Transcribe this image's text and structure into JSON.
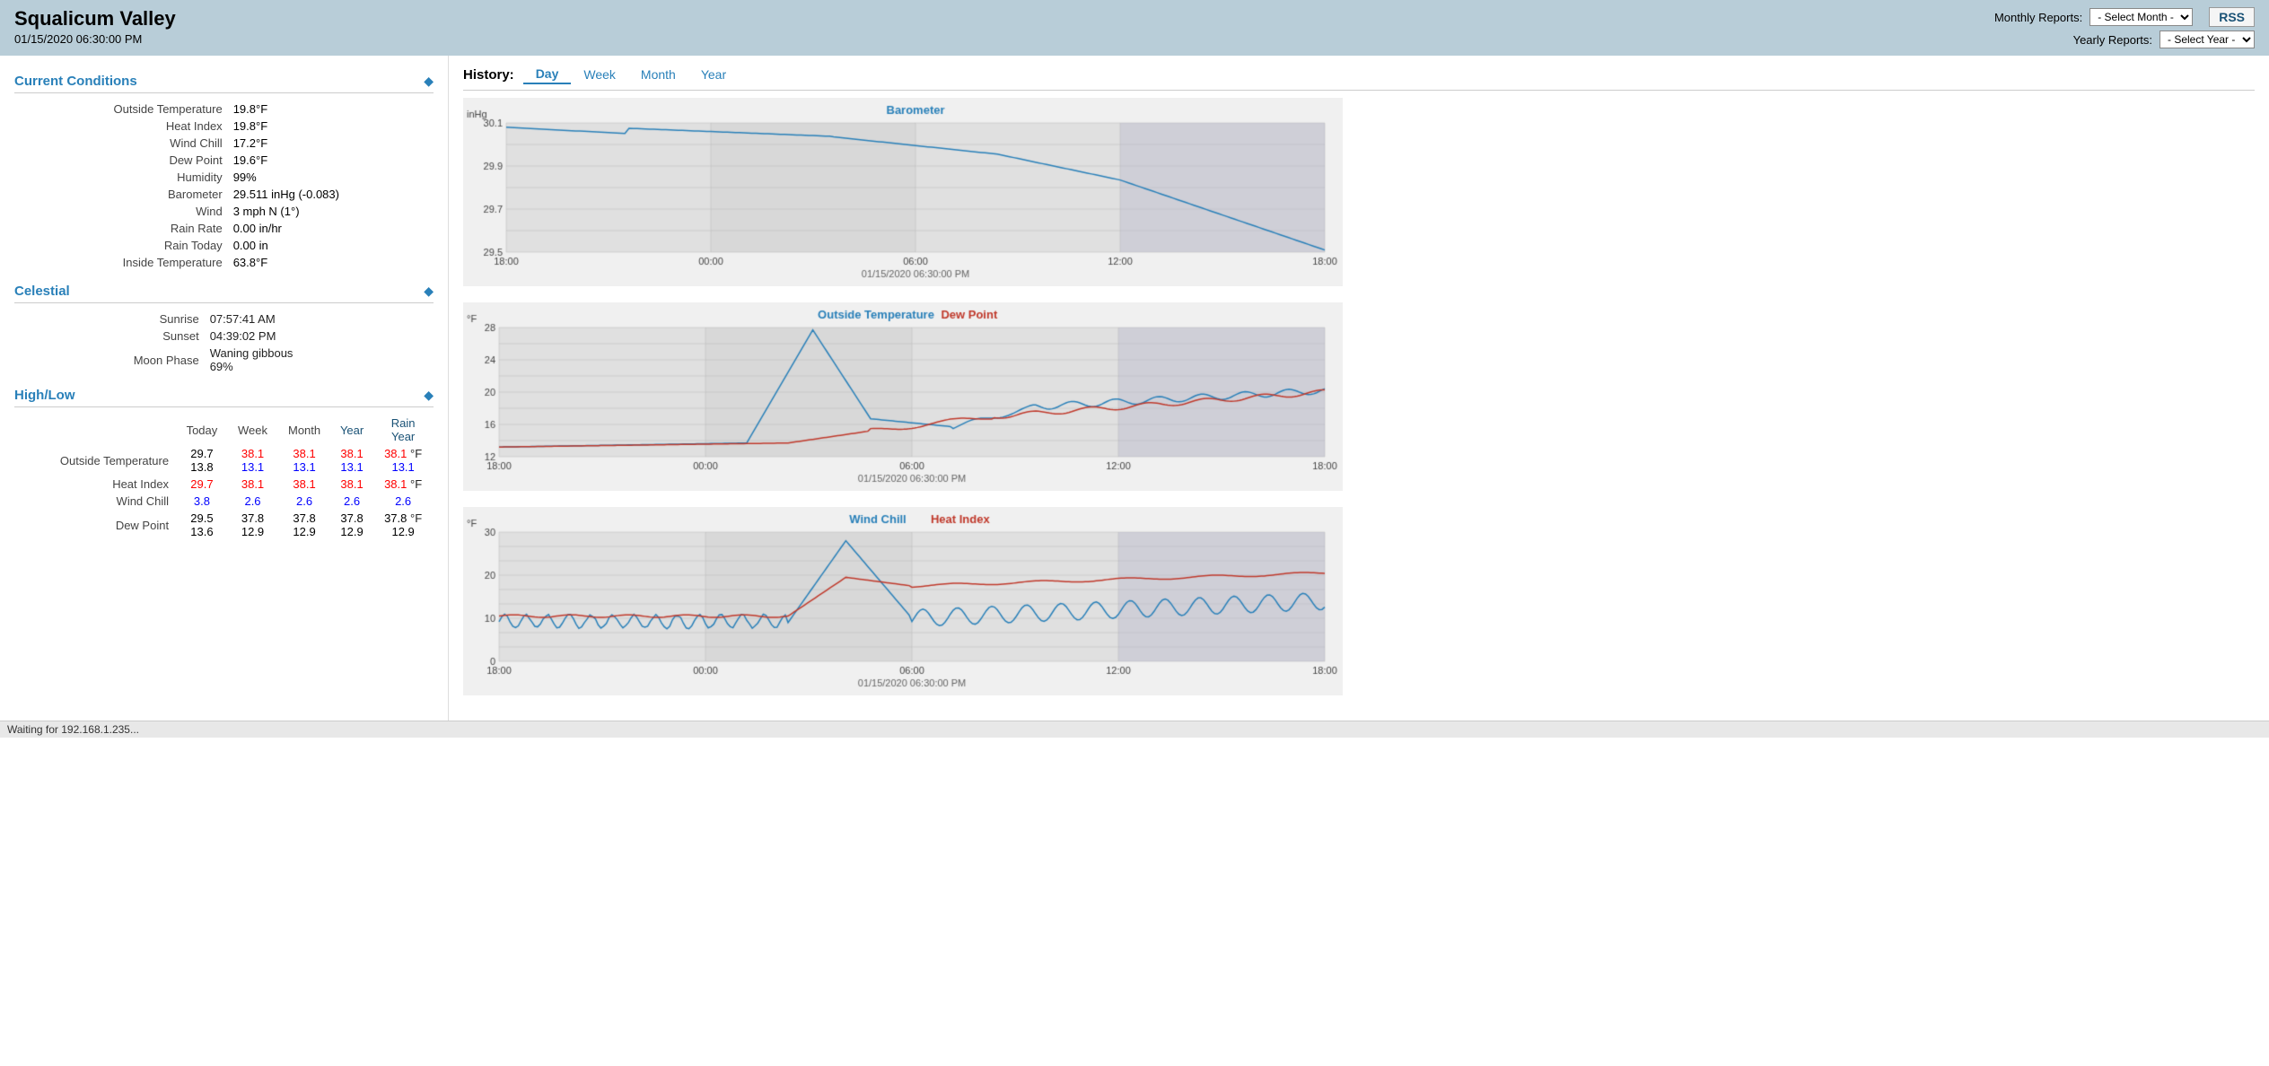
{
  "header": {
    "title": "Squalicum Valley",
    "datetime": "01/15/2020 06:30:00 PM",
    "monthly_reports_label": "Monthly Reports:",
    "yearly_reports_label": "Yearly Reports:",
    "select_month_placeholder": "- Select Month -",
    "select_year_placeholder": "- Select Year -",
    "rss_label": "RSS"
  },
  "current_conditions": {
    "section_title": "Current Conditions",
    "items": [
      {
        "label": "Outside Temperature",
        "value": "19.8°F"
      },
      {
        "label": "Heat Index",
        "value": "19.8°F"
      },
      {
        "label": "Wind Chill",
        "value": "17.2°F"
      },
      {
        "label": "Dew Point",
        "value": "19.6°F"
      },
      {
        "label": "Humidity",
        "value": "99%"
      },
      {
        "label": "Barometer",
        "value": "29.511 inHg (-0.083)"
      },
      {
        "label": "Wind",
        "value": "3 mph N (1°)"
      },
      {
        "label": "Rain Rate",
        "value": "0.00 in/hr"
      },
      {
        "label": "Rain Today",
        "value": "0.00 in"
      },
      {
        "label": "Inside Temperature",
        "value": "63.8°F"
      }
    ]
  },
  "celestial": {
    "section_title": "Celestial",
    "items": [
      {
        "label": "Sunrise",
        "value": "07:57:41 AM"
      },
      {
        "label": "Sunset",
        "value": "04:39:02 PM"
      },
      {
        "label": "Moon Phase",
        "value": "Waning gibbous\n69%"
      }
    ]
  },
  "highlow": {
    "section_title": "High/Low",
    "col_headers": [
      "Today",
      "Week",
      "Month",
      "Year",
      "Rain\nYear"
    ],
    "rows": [
      {
        "label": "Outside Temperature",
        "values": [
          [
            "29.7",
            "13.8"
          ],
          [
            "38.1",
            "13.1"
          ],
          [
            "38.1",
            "13.1"
          ],
          [
            "38.1",
            "13.1"
          ],
          [
            "38.1 °F",
            "13.1"
          ]
        ],
        "high_colors": [
          "black",
          "red",
          "red",
          "red",
          "red"
        ],
        "low_colors": [
          "black",
          "blue",
          "blue",
          "blue",
          "blue"
        ]
      },
      {
        "label": "Heat Index",
        "values": [
          [
            "29.7"
          ],
          [
            "38.1"
          ],
          [
            "38.1"
          ],
          [
            "38.1"
          ],
          [
            "38.1 °F"
          ]
        ],
        "high_colors": [
          "red",
          "red",
          "red",
          "red",
          "red"
        ]
      },
      {
        "label": "Wind Chill",
        "values": [
          [
            "3.8"
          ],
          [
            "2.6"
          ],
          [
            "2.6"
          ],
          [
            "2.6"
          ],
          [
            "2.6 °F"
          ]
        ],
        "low_colors": [
          "blue",
          "blue",
          "blue",
          "blue",
          "blue"
        ]
      },
      {
        "label": "Dew Point",
        "values": [
          [
            "29.5",
            "13.6"
          ],
          [
            "37.8",
            "12.9"
          ],
          [
            "37.8",
            "12.9"
          ],
          [
            "37.8",
            "12.9"
          ],
          [
            "37.8 °F",
            "12.9"
          ]
        ],
        "high_colors": [
          "black",
          "black",
          "black",
          "black",
          "black"
        ],
        "low_colors": [
          "black",
          "black",
          "black",
          "black",
          "black"
        ]
      }
    ]
  },
  "history": {
    "label": "History:",
    "tabs": [
      "Day",
      "Week",
      "Month",
      "Year"
    ],
    "active_tab": "Day"
  },
  "charts": {
    "barometer": {
      "title": "Barometer",
      "y_label": "inHg",
      "y_min": 29.5,
      "y_max": 30.1,
      "x_labels": [
        "18:00",
        "00:00",
        "06:00",
        "12:00",
        "18:00"
      ],
      "timestamp": "01/15/2020 06:30:00 PM"
    },
    "temp_dewpoint": {
      "title_parts": [
        {
          "text": "Outside Temperature",
          "color": "#2980b9"
        },
        {
          "text": " Dew Point",
          "color": "#c0392b"
        }
      ],
      "y_label": "°F",
      "y_min": 12,
      "y_max": 28,
      "x_labels": [
        "18:00",
        "00:00",
        "06:00",
        "12:00",
        "18:00"
      ],
      "timestamp": "01/15/2020 06:30:00 PM"
    },
    "windchill_heatindex": {
      "title_parts": [
        {
          "text": "Wind Chill",
          "color": "#2980b9"
        },
        {
          "text": " Heat Index",
          "color": "#c0392b"
        }
      ],
      "y_label": "°F",
      "y_min": 0,
      "y_max": 30,
      "x_labels": [
        "18:00",
        "00:00",
        "06:00",
        "12:00",
        "18:00"
      ],
      "timestamp": "01/15/2020 06:30:00 PM"
    }
  },
  "status_bar": {
    "text": "Waiting for 192.168.1.235..."
  }
}
